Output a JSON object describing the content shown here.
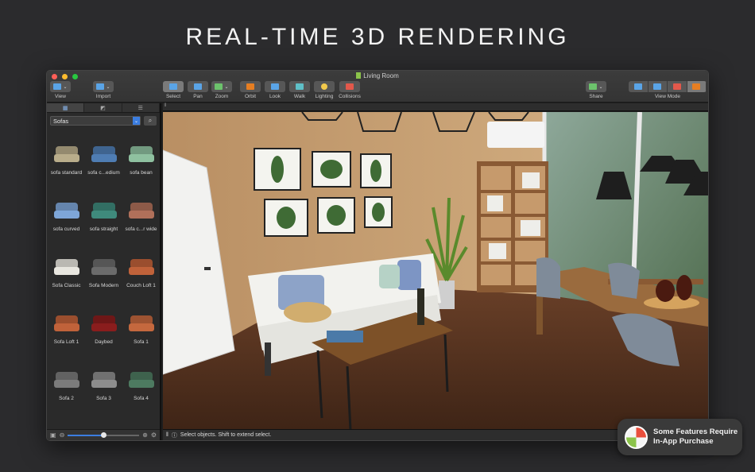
{
  "headline": "REAL-TIME 3D RENDERING",
  "window": {
    "title": "Living Room"
  },
  "toolbar": {
    "items": [
      {
        "label": "View"
      },
      {
        "label": "Import"
      },
      {
        "label": "Select"
      },
      {
        "label": "Pan"
      },
      {
        "label": "Zoom"
      },
      {
        "label": "Orbit"
      },
      {
        "label": "Look"
      },
      {
        "label": "Walk"
      },
      {
        "label": "Lighting"
      },
      {
        "label": "Collisions"
      }
    ],
    "share_label": "Share",
    "view_mode_label": "View Mode"
  },
  "sidebar": {
    "category": "Sofas",
    "items": [
      {
        "label": "sofa standard",
        "color": "#b9ad8b"
      },
      {
        "label": "sofa c...edium",
        "color": "#4f7db3"
      },
      {
        "label": "sofa bean",
        "color": "#8fc1a0"
      },
      {
        "label": "sofa curved",
        "color": "#7ea6d8"
      },
      {
        "label": "sofa straight",
        "color": "#3f8a7c"
      },
      {
        "label": "sofa c...r wide",
        "color": "#b0705a"
      },
      {
        "label": "Sofa Classic",
        "color": "#e8e6df"
      },
      {
        "label": "Sofa Modern",
        "color": "#6b6b6b"
      },
      {
        "label": "Couch Loft 1",
        "color": "#c0623a"
      },
      {
        "label": "Sofa Loft 1",
        "color": "#c0623a"
      },
      {
        "label": "Daybed",
        "color": "#8a1d1d"
      },
      {
        "label": "Sofa 1",
        "color": "#c4683e"
      },
      {
        "label": "Sofa 2",
        "color": "#7b7b7b"
      },
      {
        "label": "Sofa 3",
        "color": "#8d8d8d"
      },
      {
        "label": "Sofa 4",
        "color": "#4d7a60"
      }
    ]
  },
  "status": {
    "text": "Select objects. Shift to extend select."
  },
  "badge": {
    "line1": "Some Features Require",
    "line2": "In-App Purchase"
  }
}
